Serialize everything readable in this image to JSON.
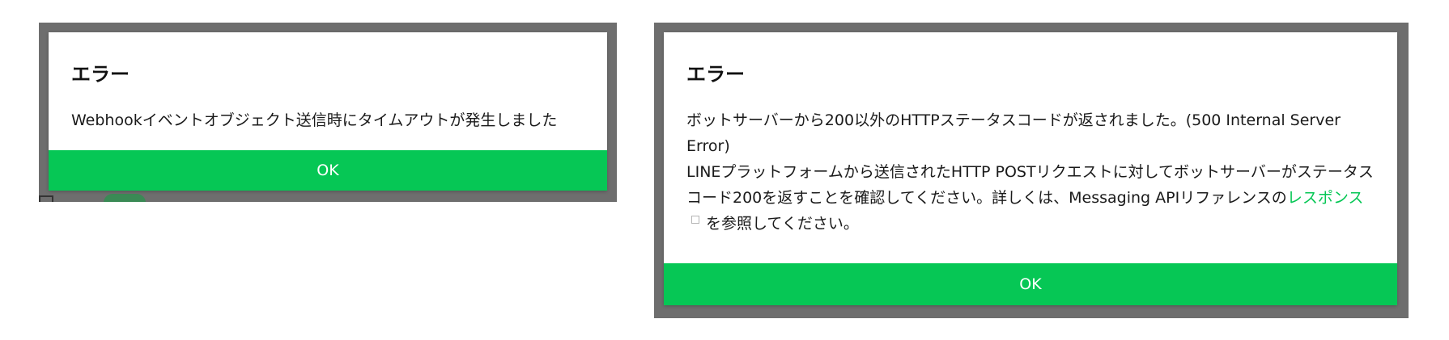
{
  "colors": {
    "accent": "#06c755",
    "backdrop": "#6e6e6e"
  },
  "dialogs": [
    {
      "title": "エラー",
      "message": "Webhookイベントオブジェクト送信時にタイムアウトが発生しました",
      "ok_label": "OK"
    },
    {
      "title": "エラー",
      "message_line1": "ボットサーバーから200以外のHTTPステータスコードが返されました。(500 Internal Server Error)",
      "message_line2_prefix": "LINEプラットフォームから送信されたHTTP POSTリクエストに対してボットサーバーがステータスコード200を返すことを確認してください。詳しくは、Messaging APIリファレンスの",
      "link_text": "レスポンス",
      "link_icon": "external-link-icon",
      "message_line2_suffix": "を参照してください。",
      "ok_label": "OK"
    }
  ]
}
